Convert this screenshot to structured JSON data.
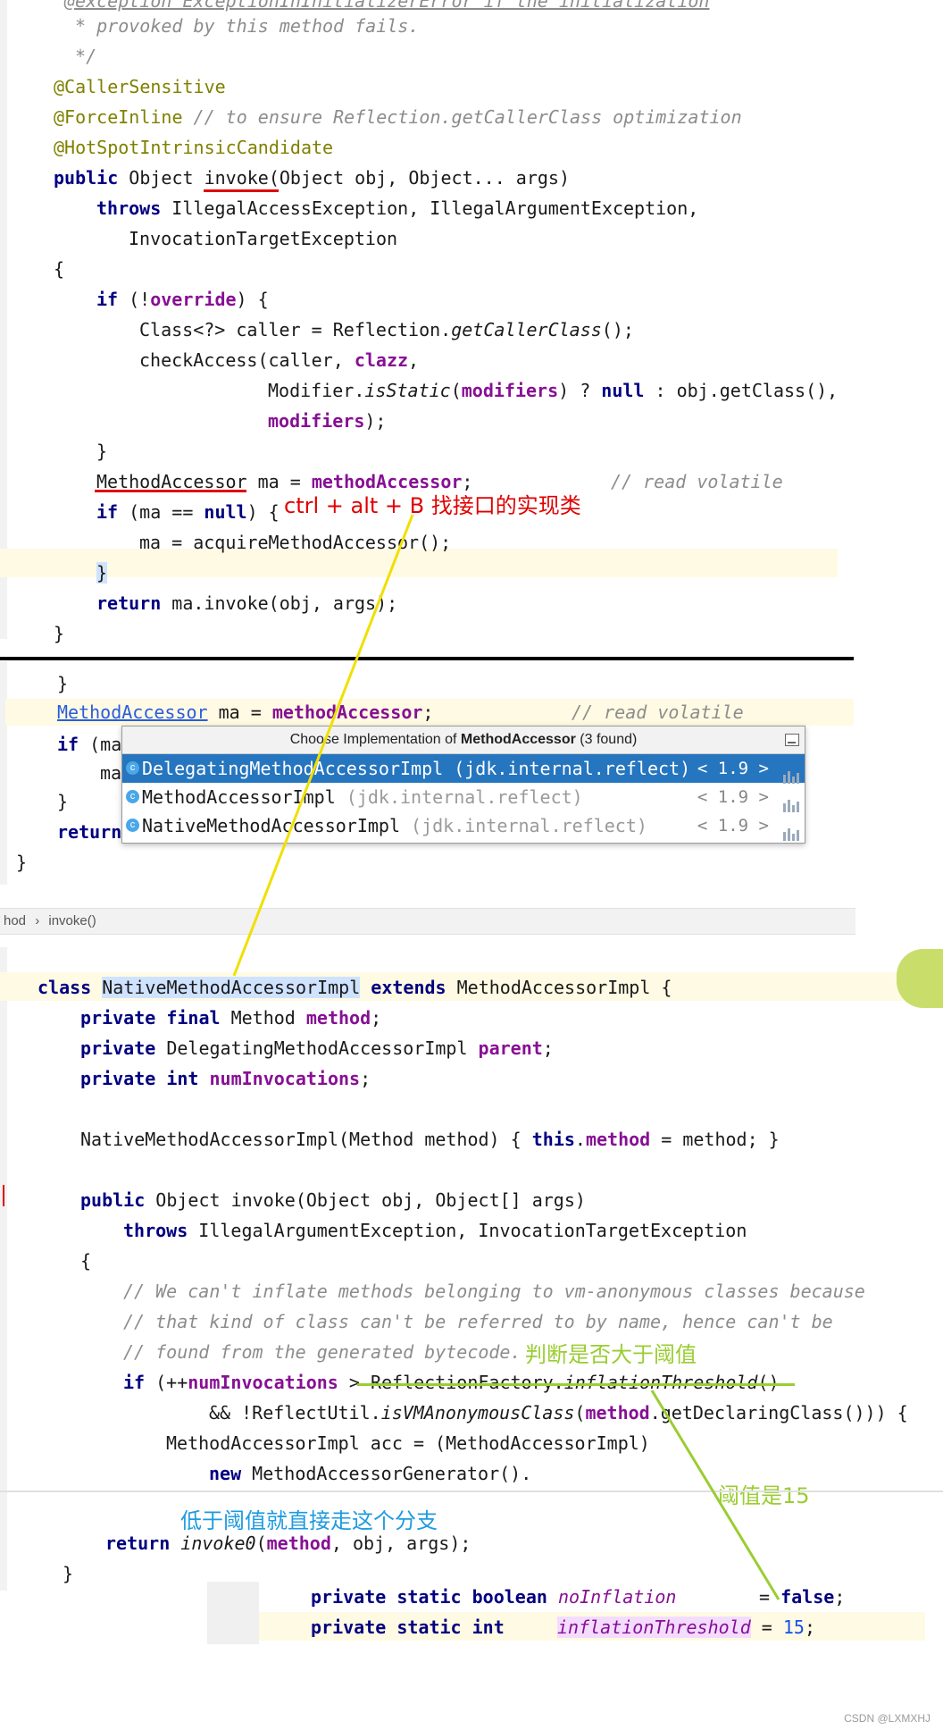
{
  "top": {
    "c1": "@exception ExceptionInInitializerError if the initialization",
    "c2": " * provoked by this method fails.",
    "c3": " */",
    "a1": "@CallerSensitive",
    "a2": "@ForceInline",
    "a2c": "// to ensure Reflection.getCallerClass optimization",
    "a3": "@HotSpotIntrinsicCandidate",
    "public": "public",
    "object": "Object",
    "invoke": "invoke",
    "sig_rest": "(Object obj, Object... args)",
    "throws": "throws",
    "throws_list": "IllegalAccessException, IllegalArgumentException,",
    "throws_2": "InvocationTargetException",
    "brace_open": "{",
    "if": "if",
    "if_cond_open": " (!",
    "override": "override",
    "if_cond_close": ") {",
    "caller_a": "Class<?> caller = Reflection.",
    "caller_b": "getCallerClass",
    "caller_c": "();",
    "check_a": "checkAccess(caller, ",
    "clazz": "clazz",
    "check_c": ",",
    "mod_a": "Modifier.",
    "mod_b": "isStatic",
    "mod_c": "(",
    "modifiers": "modifiers",
    "mod_d": ") ? ",
    "null": "null",
    "mod_e": " : obj.getClass(),",
    "mod2_b": ");",
    "close_if": "}",
    "ma_type": "MethodAccessor",
    "ma_var": " ma = ",
    "ma_field": "methodAccessor",
    "ma_semi": ";",
    "ma_comment": "// read volatile",
    "if2": "if",
    "if2_cond": " (ma == ",
    "if2_null": "null",
    "if2_close": ") {",
    "acq": "ma = acquireMethodAccessor();",
    "close_if2": "}",
    "return": "return",
    "return_rest": " ma.invoke(obj, args);",
    "close_method": "}"
  },
  "annotation_ctrl": "ctrl + alt + B 找接口的实现类",
  "middle": {
    "close1": "}",
    "ma_type": "MethodAccessor",
    "ma_var": " ma = ",
    "ma_field": "methodAccessor",
    "ma_semi": ";",
    "ma_comment": "// read volatile",
    "if": "if",
    "if_rest": " (ma",
    "ma_frag": "ma",
    "close2": "}",
    "return": "return",
    "close3": "}"
  },
  "popup": {
    "title_pre": "Choose Implementation of ",
    "title_bold": "MethodAccessor",
    "title_post": " (3 found)",
    "items": [
      {
        "name": "DelegatingMethodAccessorImpl",
        "pkg": "(jdk.internal.reflect)",
        "ver": "< 1.9 >"
      },
      {
        "name": "MethodAccessorImpl",
        "pkg": "(jdk.internal.reflect)",
        "ver": "< 1.9 >"
      },
      {
        "name": "NativeMethodAccessorImpl",
        "pkg": "(jdk.internal.reflect)",
        "ver": "< 1.9 >"
      }
    ]
  },
  "breadcrumb": {
    "left": "hod",
    "sep": "›",
    "right": "invoke()"
  },
  "bottom": {
    "class": "class",
    "classname": "NativeMethodAccessorImpl",
    "extends": "extends",
    "parent_class": "MethodAccessorImpl {",
    "p1_priv": "private",
    "p1_final": "final",
    "p1_type": " Method ",
    "p1_field": "method",
    "p1_semi": ";",
    "p2_priv": "private",
    "p2_type": " DelegatingMethodAccessorImpl ",
    "p2_field": "parent",
    "p2_semi": ";",
    "p3_priv": "private",
    "p3_int": "int",
    "p3_field": "numInvocations",
    "p3_semi": ";",
    "ctor_a": "NativeMethodAccessorImpl(Method method) { ",
    "ctor_this": "this",
    "ctor_dot": ".",
    "ctor_field": "method",
    "ctor_rest": " = method; }",
    "pub": "public",
    "pub_rest": " Object invoke(Object obj, Object[] args)",
    "throws": "throws",
    "throws_rest": " IllegalArgumentException, InvocationTargetException",
    "brace": "{",
    "cm1": "// We can't inflate methods belonging to vm-anonymous classes because",
    "cm2": "// that kind of class can't be referred to by name, hence can't be",
    "cm3": "// found from the generated bytecode.",
    "if": "if",
    "if_a": " (++",
    "if_field": "numInvocations",
    "if_b": " > ReflectionFactory.",
    "if_c": "inflationThreshold",
    "if_d": "()",
    "and_a": "&& !ReflectUtil.",
    "and_b": "isVMAnonymousClass",
    "and_c": "(",
    "and_field": "method",
    "and_d": ".getDeclaringClass())) {",
    "acc": "MethodAccessorImpl acc = (MethodAccessorImpl)",
    "new": "new",
    "new_rest": " MethodAccessorGenerator().",
    "return": "return",
    "inv0": "invoke0",
    "ret_rest": "(",
    "ret_field": "method",
    "ret_rest2": ", obj, args);",
    "close": "}"
  },
  "annotation_threshold_check": "判断是否大于阈值",
  "annotation_threshold_value": "阈值是15",
  "annotation_branch": "低于阈值就直接走这个分支",
  "snippet": {
    "l1_priv": "private",
    "l1_static": "static",
    "l1_bool": "boolean",
    "l1_field": "noInflation",
    "l1_eq": "= ",
    "l1_val": "false",
    "l1_semi": ";",
    "l2_priv": "private",
    "l2_static": "static",
    "l2_int": "int",
    "l2_field": "inflationThreshold",
    "l2_eq": " = ",
    "l2_val": "15",
    "l2_semi": ";"
  },
  "watermark": "CSDN @LXMXHJ",
  "colors": {
    "keyword": "#000080",
    "annotation": "#808000",
    "field": "#871094",
    "comment": "#8c8c8c",
    "number": "#1750eb",
    "popup_selected": "#2675bf",
    "annotation_red": "#e00000",
    "annotation_green": "#9acd32",
    "annotation_cyan": "#1e9be0",
    "arrow_yellow": "#f0e000"
  }
}
